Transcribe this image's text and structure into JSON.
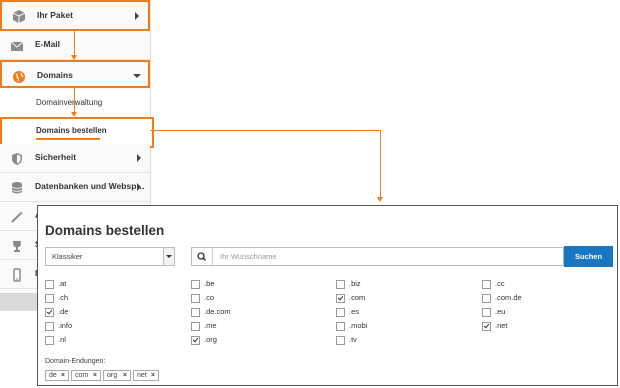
{
  "sidebar": {
    "items": [
      {
        "label": "Ihr Paket",
        "icon": "package-icon"
      },
      {
        "label": "E-Mail",
        "icon": "envelope-icon"
      },
      {
        "label": "Domains",
        "icon": "globe-icon"
      },
      {
        "label": "Sicherheit",
        "icon": "shield-icon"
      },
      {
        "label": "Datenbanken und Websp…",
        "icon": "database-icon"
      },
      {
        "label": "A",
        "icon": "wand-icon"
      },
      {
        "label": "S",
        "icon": "trophy-icon"
      },
      {
        "label": "I",
        "icon": "mobile-icon"
      }
    ],
    "subitems": [
      {
        "label": "Domainverwaltung"
      },
      {
        "label": "Domains bestellen"
      }
    ]
  },
  "panel": {
    "title": "Domains bestellen",
    "select_value": "Klassiker",
    "search_placeholder": "Ihr Wunschname",
    "search_button": "Suchen",
    "tlds": [
      {
        "label": ".at",
        "checked": false
      },
      {
        "label": ".be",
        "checked": false
      },
      {
        "label": ".biz",
        "checked": false
      },
      {
        "label": ".cc",
        "checked": false
      },
      {
        "label": ".ch",
        "checked": false
      },
      {
        "label": ".co",
        "checked": false
      },
      {
        "label": ".com",
        "checked": true
      },
      {
        "label": ".com.de",
        "checked": false
      },
      {
        "label": ".de",
        "checked": true
      },
      {
        "label": ".de.com",
        "checked": false
      },
      {
        "label": ".es",
        "checked": false
      },
      {
        "label": ".eu",
        "checked": false
      },
      {
        "label": ".info",
        "checked": false
      },
      {
        "label": ".me",
        "checked": false
      },
      {
        "label": ".mobi",
        "checked": false
      },
      {
        "label": ".net",
        "checked": true
      },
      {
        "label": ".nl",
        "checked": false
      },
      {
        "label": ".org",
        "checked": true
      },
      {
        "label": ".tv",
        "checked": false
      }
    ],
    "endungen_label": "Domain-Endungen:",
    "tags": [
      "de",
      "com",
      "org",
      "net"
    ]
  },
  "colors": {
    "accent": "#ef7d1a",
    "button": "#1877c0"
  }
}
